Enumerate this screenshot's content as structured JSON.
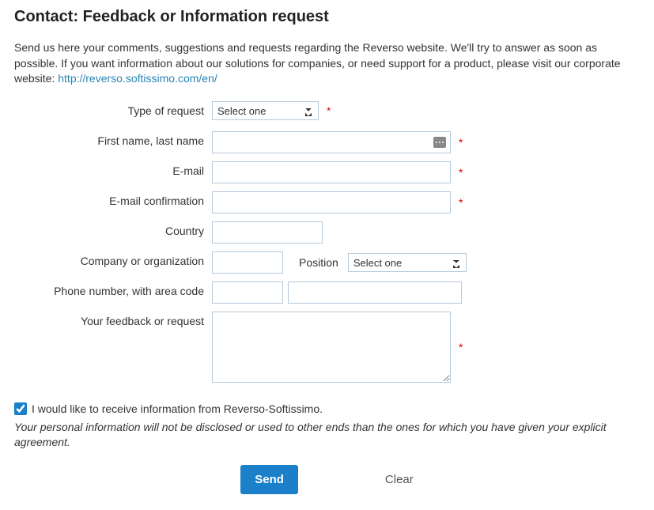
{
  "title": "Contact: Feedback or Information request",
  "intro": {
    "text_before": "Send us here your comments, suggestions and requests regarding the Reverso website. We'll try to answer as soon as possible. If you want information about our solutions for companies, or need support for a product, please visit our corporate website: ",
    "link_text": "http://reverso.softissimo.com/en/"
  },
  "form": {
    "type": {
      "label": "Type of request",
      "selected": "Select one"
    },
    "name": {
      "label": "First name, last name",
      "value": ""
    },
    "email": {
      "label": "E-mail",
      "value": ""
    },
    "email_conf": {
      "label": "E-mail confirmation",
      "value": ""
    },
    "country": {
      "label": "Country",
      "value": ""
    },
    "company": {
      "label": "Company or organization",
      "value": ""
    },
    "position": {
      "label": "Position",
      "selected": "Select one"
    },
    "phone": {
      "label": "Phone number, with area code",
      "code": "",
      "number": ""
    },
    "feedback": {
      "label": "Your feedback or request",
      "value": ""
    },
    "consent": {
      "label": "I would like to receive information from Reverso-Softissimo.",
      "checked": true
    }
  },
  "disclaimer": "Your personal information will not be disclosed or used to other ends than the ones for which you have given your explicit agreement.",
  "buttons": {
    "send": "Send",
    "clear": "Clear"
  }
}
